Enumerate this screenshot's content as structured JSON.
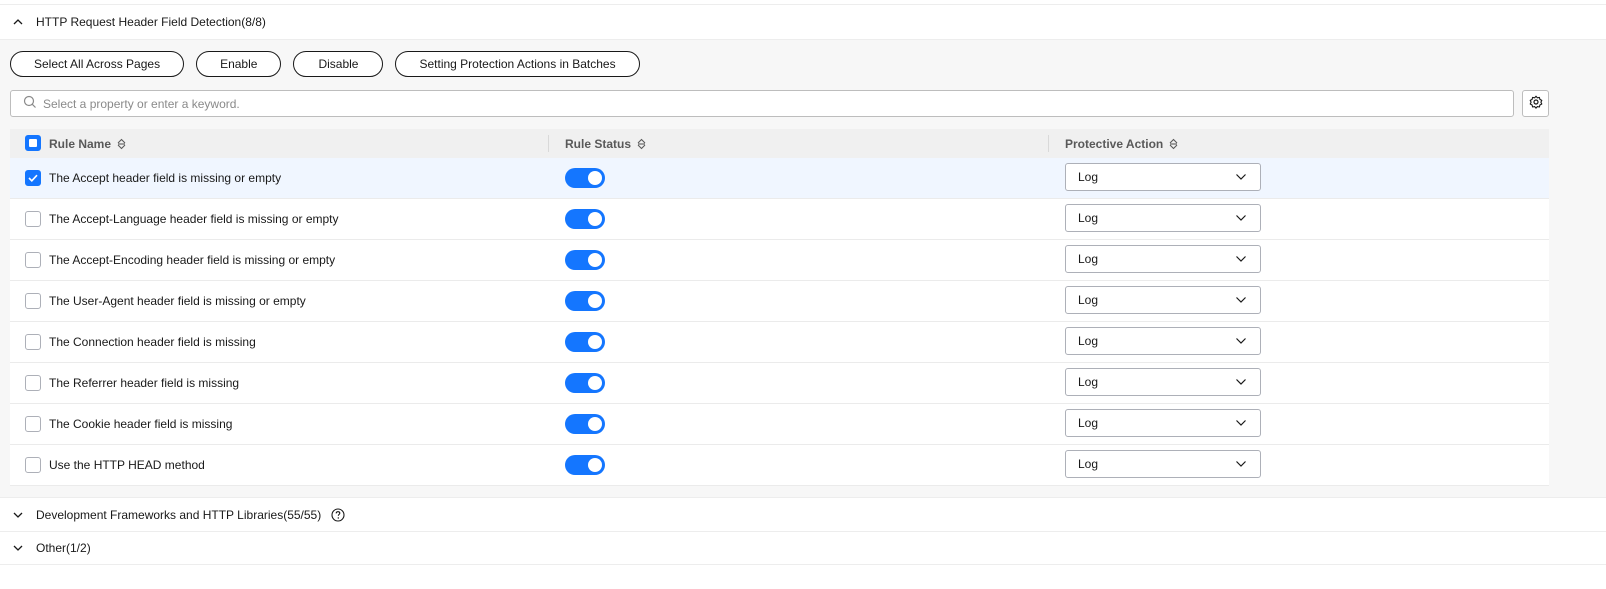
{
  "sections": {
    "http_header": {
      "title": "HTTP Request Header Field Detection(8/8)",
      "expanded": true
    },
    "frameworks": {
      "title": "Development Frameworks and HTTP Libraries(55/55)",
      "expanded": false
    },
    "other": {
      "title": "Other(1/2)",
      "expanded": false
    }
  },
  "toolbar": {
    "select_all_label": "Select All Across Pages",
    "enable_label": "Enable",
    "disable_label": "Disable",
    "batch_actions_label": "Setting Protection Actions in Batches"
  },
  "search": {
    "placeholder": "Select a property or enter a keyword."
  },
  "table": {
    "columns": {
      "rule_name": "Rule Name",
      "rule_status": "Rule Status",
      "protective_action": "Protective Action"
    },
    "rows": [
      {
        "name": "The Accept header field is missing or empty",
        "checked": true,
        "status_enabled": true,
        "action": "Log"
      },
      {
        "name": "The Accept-Language header field is missing or empty",
        "checked": false,
        "status_enabled": true,
        "action": "Log"
      },
      {
        "name": "The Accept-Encoding header field is missing or empty",
        "checked": false,
        "status_enabled": true,
        "action": "Log"
      },
      {
        "name": "The User-Agent header field is missing or empty",
        "checked": false,
        "status_enabled": true,
        "action": "Log"
      },
      {
        "name": "The Connection header field is missing",
        "checked": false,
        "status_enabled": true,
        "action": "Log"
      },
      {
        "name": "The Referrer header field is missing",
        "checked": false,
        "status_enabled": true,
        "action": "Log"
      },
      {
        "name": "The Cookie header field is missing",
        "checked": false,
        "status_enabled": true,
        "action": "Log"
      },
      {
        "name": "Use the HTTP HEAD method",
        "checked": false,
        "status_enabled": true,
        "action": "Log"
      }
    ]
  },
  "colors": {
    "accent": "#1476ff",
    "toggle_on": "#1476ff",
    "selected_row": "#f0f6ff"
  }
}
